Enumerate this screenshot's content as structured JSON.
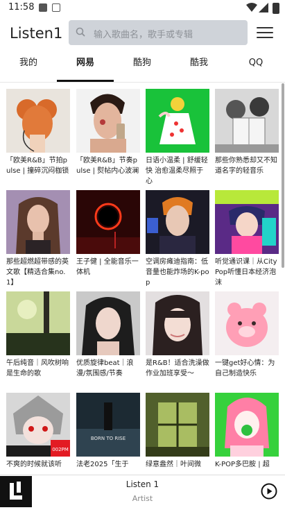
{
  "status": {
    "time": "11:58"
  },
  "header": {
    "title": "Listen1",
    "search_placeholder": "输入歌曲名，歌手或专辑"
  },
  "tabs": [
    {
      "label": "我的"
    },
    {
      "label": "网易"
    },
    {
      "label": "酷狗"
    },
    {
      "label": "酷我"
    },
    {
      "label": "QQ"
    }
  ],
  "active_tab": "网易",
  "playlists": [
    {
      "caption": "「欧美R&B」节拍pulse | 撞碎沉闷枷锁"
    },
    {
      "caption": "「欧美R&B」节奏pulse | 熨帖内心波澜"
    },
    {
      "caption": "日语小温柔 | 舒缓轻快 治愈温柔尽照于心"
    },
    {
      "caption": "那些你熟悉却又不知道名字的轻音乐"
    },
    {
      "caption": "那些超燃超带感的英文歌【精选合集no.1】"
    },
    {
      "caption": "王子健 | 全能音乐一体机"
    },
    {
      "caption": "空调房瘫迪指南：低音量也能炸场的K-pop"
    },
    {
      "caption": "听觉通识课｜从City Pop听懂日本经济泡沫"
    },
    {
      "caption": "午后纯音｜风吹树响是生命的歌"
    },
    {
      "caption": "优质旋律beat｜浪漫/氛围感/节奏"
    },
    {
      "caption": "是R&B！适合洗澡做作业加班享受～"
    },
    {
      "caption": "一键get好心情：为自己制造快乐"
    },
    {
      "caption": "不爽的时候就该听"
    },
    {
      "caption": "法老2025「生于"
    },
    {
      "caption": "绿意盎然｜叶间微"
    },
    {
      "caption": "K-POP多巴胺 | 超"
    }
  ],
  "cover_texts": {
    "c14": "BORN TO RISE",
    "c16": "002PM"
  },
  "player": {
    "song": "Listen 1",
    "artist": "Artist"
  },
  "colors": {
    "accent": "#111111",
    "search_bg": "#cfd3d9"
  }
}
